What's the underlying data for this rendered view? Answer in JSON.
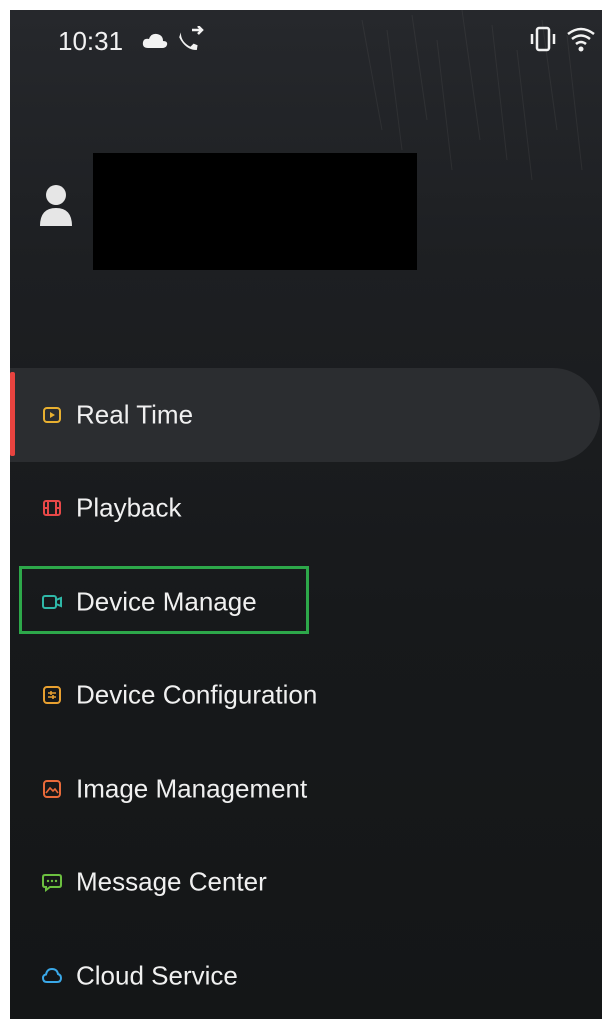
{
  "status_bar": {
    "time": "10:31",
    "icons": [
      "cloud-icon",
      "call-forward-icon",
      "vibrate-icon",
      "wifi-icon"
    ]
  },
  "profile": {
    "avatar_icon": "user-avatar-icon"
  },
  "menu": {
    "items": [
      {
        "label": "Real Time",
        "icon": "play-icon",
        "color": "#e8b030",
        "active": true
      },
      {
        "label": "Playback",
        "icon": "film-icon",
        "color": "#e84848"
      },
      {
        "label": "Device Manage",
        "icon": "camera-icon",
        "color": "#2fb8a8"
      },
      {
        "label": "Device Configuration",
        "icon": "settings-sliders-icon",
        "color": "#e8a030"
      },
      {
        "label": "Image Management",
        "icon": "image-icon",
        "color": "#e86a3a"
      },
      {
        "label": "Message Center",
        "icon": "message-icon",
        "color": "#6cc040"
      },
      {
        "label": "Cloud Service",
        "icon": "cloud-icon",
        "color": "#3aa8e8"
      }
    ]
  },
  "colors": {
    "accent": "#e8433f",
    "highlight": "#2da84a"
  }
}
